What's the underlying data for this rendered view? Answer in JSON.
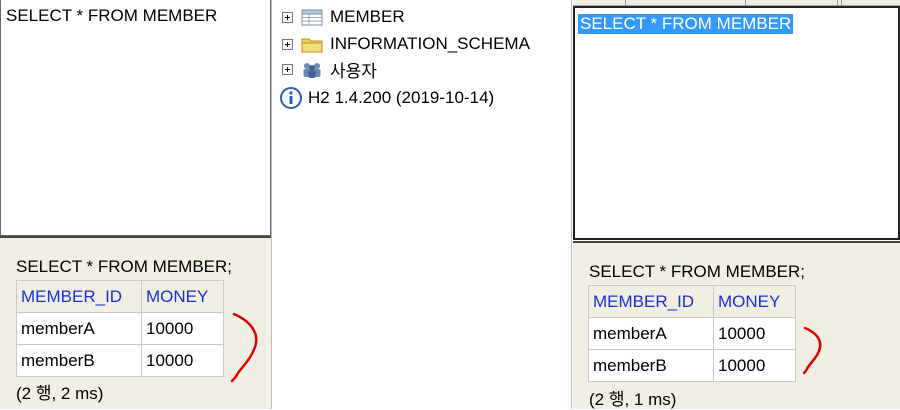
{
  "left": {
    "editor_sql": "SELECT * FROM MEMBER",
    "result_sql": "SELECT * FROM MEMBER;",
    "columns": [
      "MEMBER_ID",
      "MONEY"
    ],
    "rows": [
      [
        "memberA",
        "10000"
      ],
      [
        "memberB",
        "10000"
      ]
    ],
    "status": "(2 행, 2 ms)"
  },
  "tree": {
    "items": [
      {
        "label": "MEMBER",
        "icon": "table-icon"
      },
      {
        "label": "INFORMATION_SCHEMA",
        "icon": "folder-icon"
      },
      {
        "label": "사용자",
        "icon": "users-icon"
      }
    ],
    "version": "H2 1.4.200 (2019-10-14)"
  },
  "right": {
    "editor_sql": "SELECT * FROM MEMBER",
    "result_sql": "SELECT * FROM MEMBER;",
    "columns": [
      "MEMBER_ID",
      "MONEY"
    ],
    "rows": [
      [
        "memberA",
        "10000"
      ],
      [
        "memberB",
        "10000"
      ]
    ],
    "status": "(2 행, 1 ms)"
  },
  "colors": {
    "header_text": "#1a2fd6",
    "selection": "#3399ff",
    "annotation": "#e00000",
    "result_bg": "#f1efe3"
  }
}
